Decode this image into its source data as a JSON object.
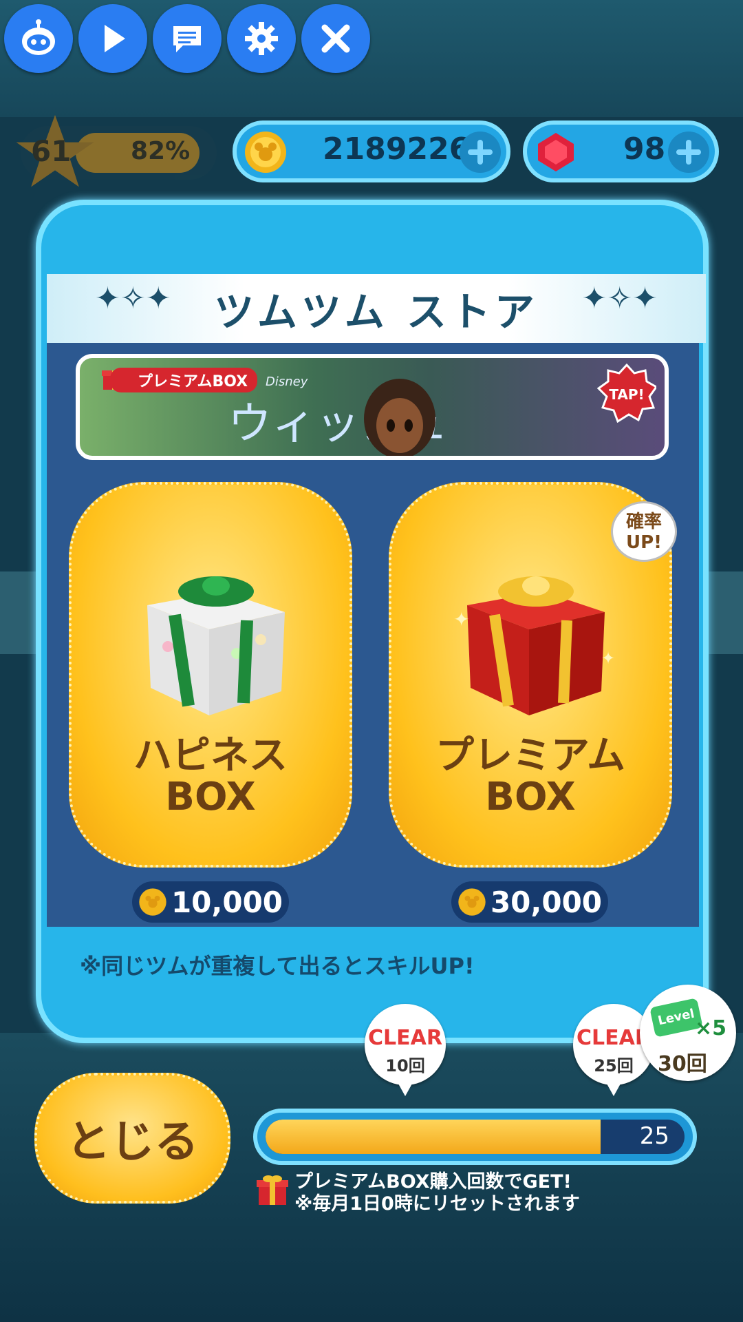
{
  "player": {
    "level": "61",
    "level_percent": "82%",
    "coins": "2189226",
    "gems": "98"
  },
  "store": {
    "title": "ツムツム ストア",
    "promo": {
      "tag": "プレミアムBOX",
      "brand": "Disney",
      "title": "ウィッシュ",
      "tap": "TAP!"
    },
    "boxes": [
      {
        "name_line1": "ハピネス",
        "name_line2": "BOX",
        "price": "10,000",
        "ribbon_color": "#1e8a3a"
      },
      {
        "name_line1": "プレミアム",
        "name_line2": "BOX",
        "price": "30,000",
        "ribbon_color": "#f2c230"
      }
    ],
    "badge": {
      "line1": "確率",
      "line2": "UP!"
    },
    "note": "※同じツムが重複して出るとスキルUP!"
  },
  "bottom": {
    "close_label": "とじる",
    "progress": {
      "value": "25",
      "fraction": 0.8
    },
    "milestones": [
      {
        "label": "CLEAR",
        "count": "10回"
      },
      {
        "label": "CLEAR",
        "count": "25回"
      }
    ],
    "reward": {
      "ticket": "Level",
      "multiplier": "×5",
      "count": "30回"
    },
    "info_line1": "プレミアムBOX購入回数でGET!",
    "info_line2": "※毎月1日0時にリセットされます"
  },
  "colors": {
    "accent_blue": "#27b5ea",
    "button_gold": "#ffc11c",
    "panel_inner": "#2c5890",
    "text_brown": "#6b3f12"
  },
  "icons": [
    "robot-icon",
    "play-icon",
    "chat-icon",
    "gear-icon",
    "close-icon",
    "star-icon",
    "coin-icon",
    "gem-icon",
    "plus-icon",
    "gift-icon"
  ]
}
